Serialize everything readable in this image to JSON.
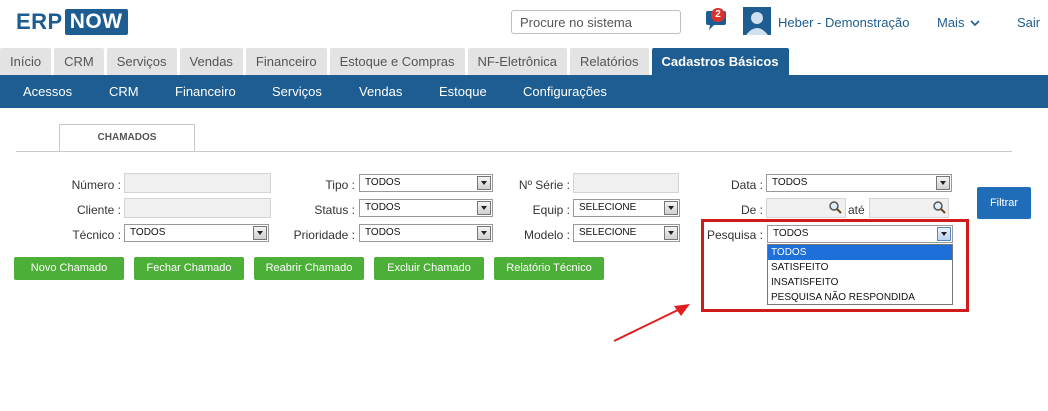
{
  "logo": {
    "part1": "ERP",
    "part2": "NOW"
  },
  "header": {
    "search_placeholder": "Procure no sistema",
    "notification_count": "2",
    "user_name": "Heber - Demonstração",
    "more_label": "Mais",
    "logout_label": "Sair"
  },
  "main_tabs": [
    "Início",
    "CRM",
    "Serviços",
    "Vendas",
    "Financeiro",
    "Estoque e Compras",
    "NF-Eletrônica",
    "Relatórios",
    "Cadastros Básicos"
  ],
  "sub_nav": [
    "Acessos",
    "CRM",
    "Financeiro",
    "Serviços",
    "Vendas",
    "Estoque",
    "Configurações"
  ],
  "section_tab": "CHAMADOS",
  "form": {
    "numero_label": "Número :",
    "cliente_label": "Cliente :",
    "tecnico_label": "Técnico :",
    "tecnico_value": "TODOS",
    "tipo_label": "Tipo :",
    "tipo_value": "TODOS",
    "status_label": "Status :",
    "status_value": "TODOS",
    "prioridade_label": "Prioridade :",
    "prioridade_value": "TODOS",
    "serie_label": "Nº Série :",
    "equip_label": "Equip :",
    "equip_value": "SELECIONE",
    "modelo_label": "Modelo :",
    "modelo_value": "SELECIONE",
    "data_label": "Data :",
    "data_value": "TODOS",
    "de_label": "De :",
    "ate_label": "até",
    "pesquisa_label": "Pesquisa :",
    "pesquisa_value": "TODOS",
    "pesquisa_options": [
      "TODOS",
      "SATISFEITO",
      "INSATISFEITO",
      "PESQUISA NÃO RESPONDIDA"
    ]
  },
  "buttons": {
    "novo": "Novo Chamado",
    "fechar": "Fechar Chamado",
    "reabrir": "Reabrir Chamado",
    "excluir": "Excluir Chamado",
    "relatorio": "Relatório Técnico",
    "filtrar": "Filtrar"
  },
  "colors": {
    "brand_blue": "#1e5d91",
    "button_green": "#4caf38",
    "filter_blue": "#1f6db8",
    "highlight_red": "#d01b1b"
  }
}
